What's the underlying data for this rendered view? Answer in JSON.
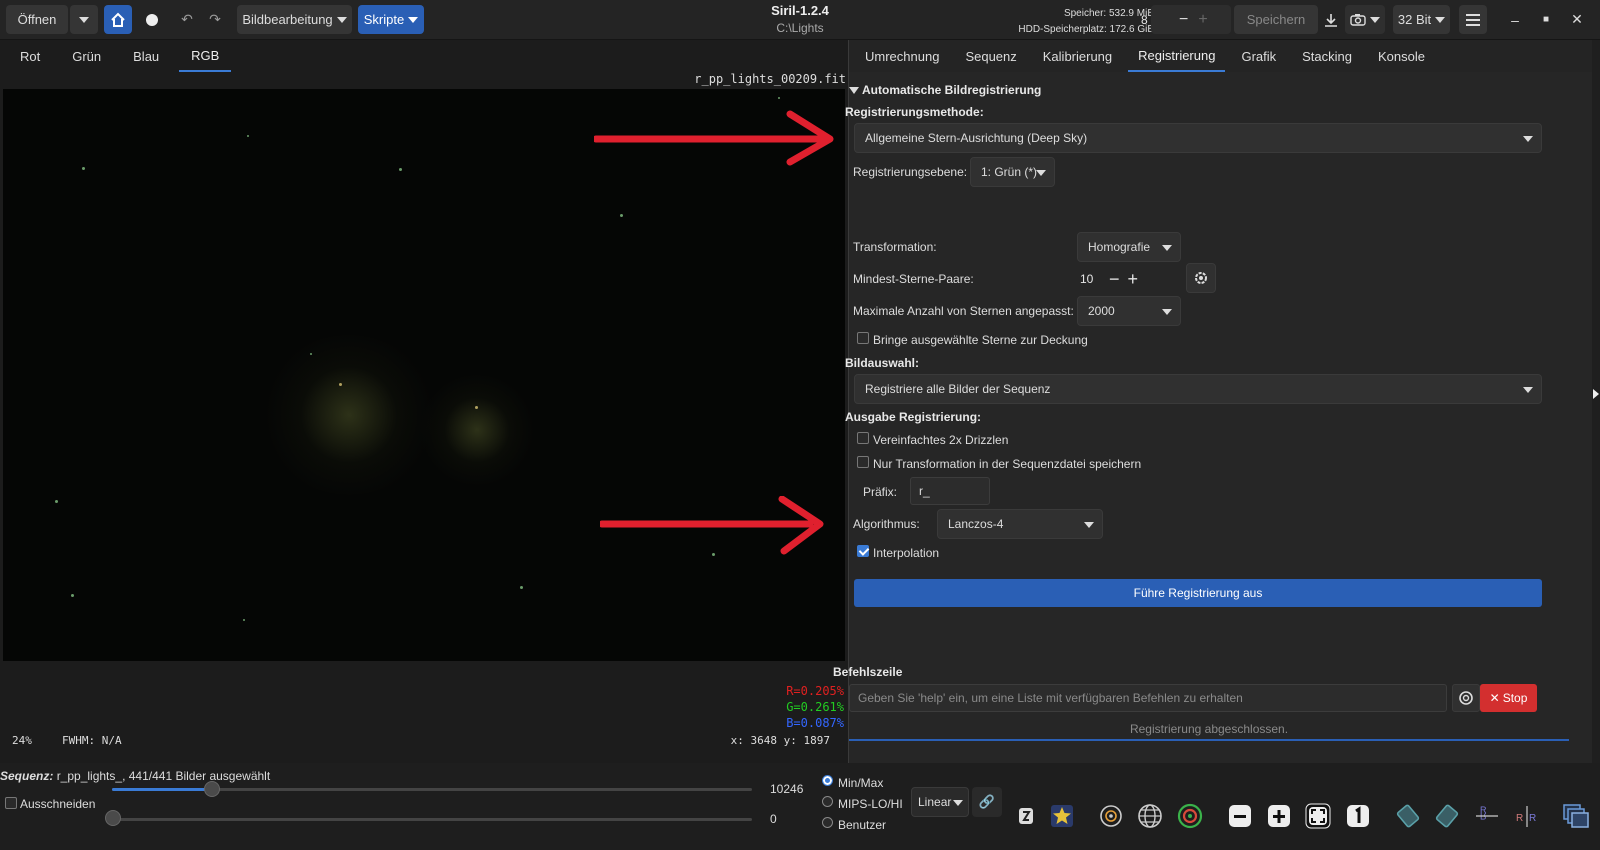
{
  "header": {
    "open_label": "Öffnen",
    "image_processing_label": "Bildbearbeitung",
    "scripts_label": "Skripte",
    "app_title": "Siril-1.2.4",
    "working_dir": "C:\\Lights",
    "memory": "Speicher: 532.9 MiB",
    "disk": "HDD-Speicherplatz: 172.6 GiB",
    "threads_value": "8",
    "save_label": "Speichern",
    "bitdepth_label": "32 Bit"
  },
  "left": {
    "tabs": [
      "Rot",
      "Grün",
      "Blau",
      "RGB"
    ],
    "active_tab": "RGB",
    "filename": "r_pp_lights_00209.fit",
    "r_value": "R=0.205%",
    "g_value": "G=0.261%",
    "b_value": "B=0.087%",
    "zoom": "24%",
    "fwhm": "FWHM: N/A",
    "coords": "x: 3648 y: 1897"
  },
  "right": {
    "tabs": [
      "Umrechnung",
      "Sequenz",
      "Kalibrierung",
      "Registrierung",
      "Grafik",
      "Stacking",
      "Konsole"
    ],
    "active_tab": "Registrierung",
    "section_title": "Automatische Bildregistrierung",
    "method_label": "Registrierungsmethode:",
    "method_value": "Allgemeine Stern-Ausrichtung (Deep Sky)",
    "layer_label": "Registrierungsebene:",
    "layer_value": "1: Grün (*)",
    "transform_label": "Transformation:",
    "transform_value": "Homografie",
    "min_pairs_label": "Mindest-Sterne-Paare:",
    "min_pairs_value": "10",
    "max_stars_label": "Maximale Anzahl von Sternen angepasst:",
    "max_stars_value": "2000",
    "match_stars_label": "Bringe ausgewählte Sterne zur Deckung",
    "selection_label": "Bildauswahl:",
    "selection_value": "Registriere alle Bilder der Sequenz",
    "output_label": "Ausgabe Registrierung:",
    "drizzle_label": "Vereinfachtes 2x Drizzlen",
    "transform_only_label": "Nur Transformation in der Sequenzdatei speichern",
    "prefix_label": "Präfix:",
    "prefix_value": "r_",
    "algorithm_label": "Algorithmus:",
    "algorithm_value": "Lanczos-4",
    "interpolation_label": "Interpolation",
    "run_label": "Führe Registrierung aus",
    "cmdline_label": "Befehlszeile",
    "cmd_placeholder": "Geben Sie 'help' ein, um eine Liste mit verfügbaren Befehlen zu erhalten",
    "stop_label": "Stop",
    "status_text": "Registrierung abgeschlossen."
  },
  "bottom": {
    "seq_label": "Sequenz:",
    "seq_text": "r_pp_lights_, 441/441 Bilder ausgewählt",
    "crop_label": "Ausschneiden",
    "slider_max_value": "10246",
    "slider_min_value": "0",
    "radio_minmax": "Min/Max",
    "radio_mips": "MIPS-LO/HI",
    "radio_user": "Benutzer",
    "stretch_label": "Linear"
  },
  "colors": {
    "accent": "#2a5fb5",
    "stop": "#d32f2f",
    "arrow": "#e0202e",
    "r_text": "#e02020",
    "g_text": "#22cc22",
    "b_text": "#3366ff"
  }
}
